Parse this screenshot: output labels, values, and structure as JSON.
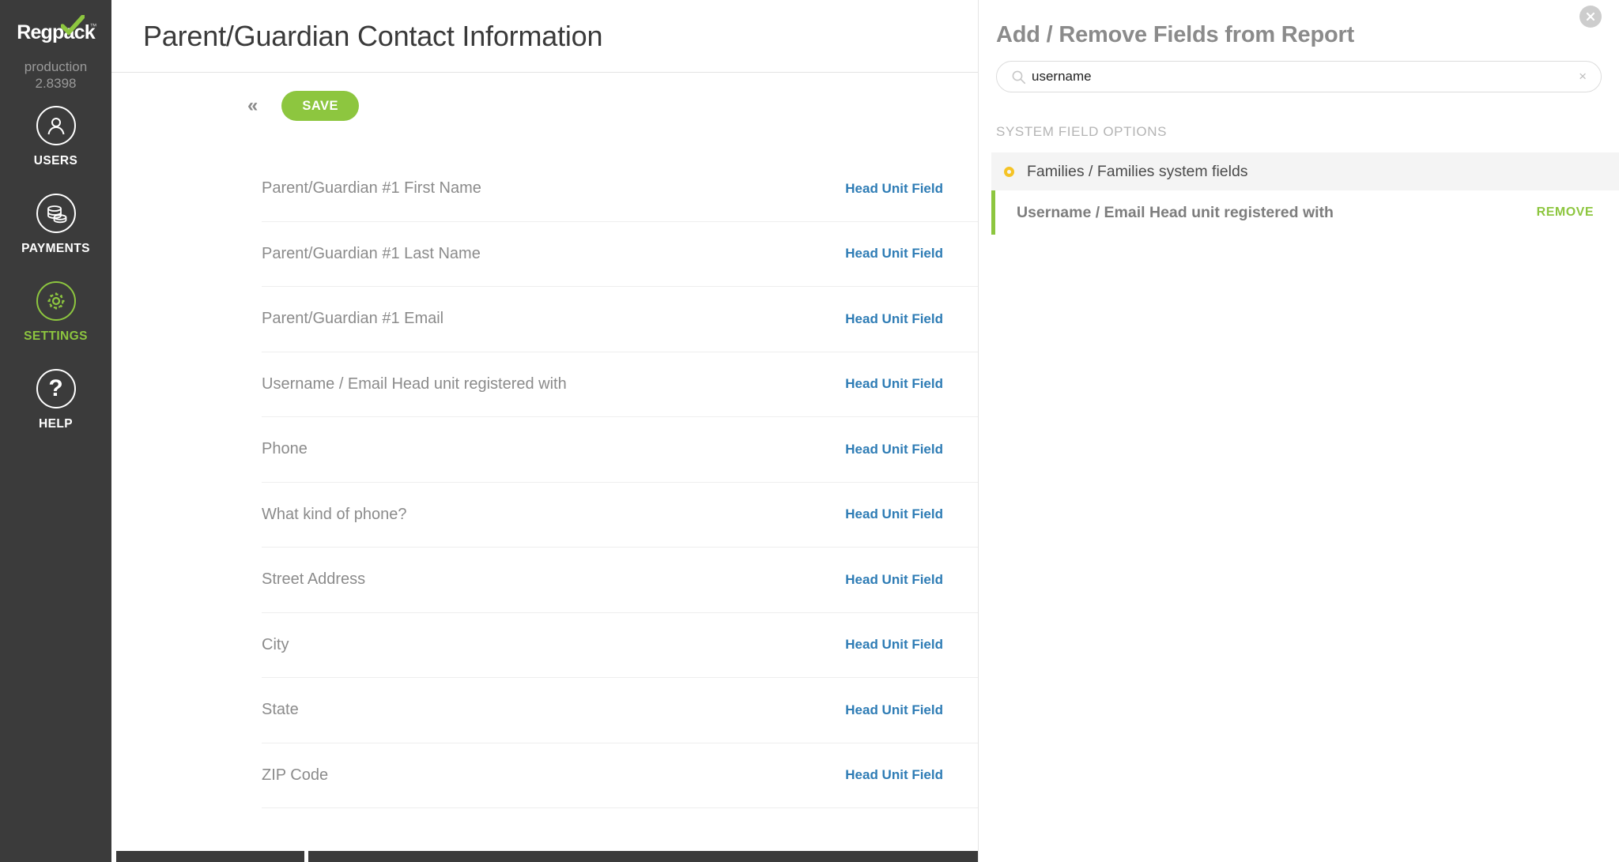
{
  "sidebar": {
    "logo_text": "Regpack",
    "logo_tm": "™",
    "version_line1": "production",
    "version_line2": "2.8398",
    "items": [
      {
        "label": "USERS",
        "icon": "user-circle-icon",
        "active": false
      },
      {
        "label": "PAYMENTS",
        "icon": "coins-circle-icon",
        "active": false
      },
      {
        "label": "SETTINGS",
        "icon": "gear-circle-icon",
        "active": true
      },
      {
        "label": "HELP",
        "icon": "question-circle-icon",
        "active": false
      }
    ]
  },
  "main": {
    "title": "Parent/Guardian Contact Information",
    "collapse_label": "«",
    "save_label": "SAVE",
    "link_label": "Head Unit Field",
    "fields": [
      "Parent/Guardian #1 First Name",
      "Parent/Guardian #1 Last Name",
      "Parent/Guardian #1 Email",
      "Username / Email Head unit registered with",
      "Phone",
      "What kind of phone?",
      "Street Address",
      "City",
      "State",
      "ZIP Code"
    ]
  },
  "right_panel": {
    "title": "Add / Remove Fields from Report",
    "close_label": "×",
    "search": {
      "value": "username",
      "placeholder": "",
      "clear_label": "×"
    },
    "section_label": "SYSTEM FIELD OPTIONS",
    "group": {
      "label": "Families / Families system fields"
    },
    "results": [
      {
        "label": "Username / Email Head unit registered with",
        "action_label": "REMOVE"
      }
    ]
  },
  "colors": {
    "brand_green": "#8DC63F",
    "link_blue": "#2E7CB5",
    "sidebar_dark": "#3B3B3B",
    "bullet_gold": "#F5C325"
  }
}
